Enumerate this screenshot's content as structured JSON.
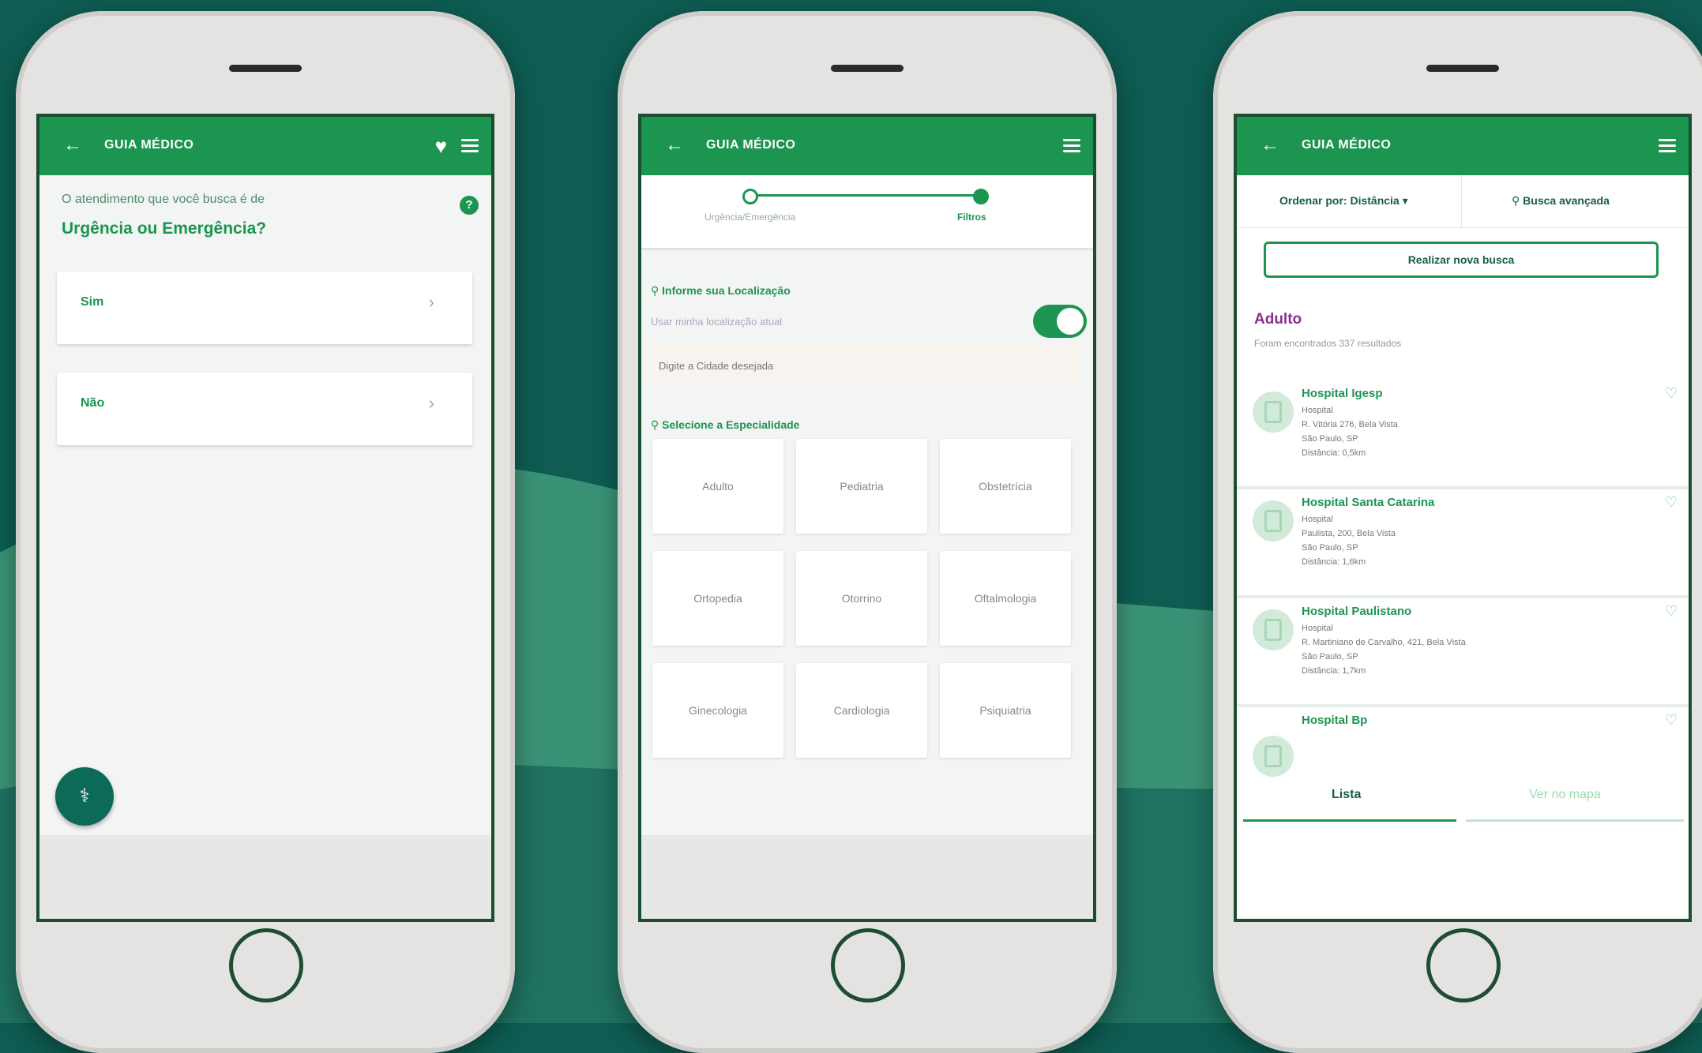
{
  "colors": {
    "brand_green": "#1c9550",
    "dark_green": "#0e5c52",
    "accent_purple": "#8a2d8f"
  },
  "phone1": {
    "title": "GUIA MÉDICO",
    "question": "O atendimento que você busca é de",
    "question_em": "Urgência ou Emergência?",
    "options": [
      {
        "label": "Sim"
      },
      {
        "label": "Não"
      }
    ],
    "icons": [
      "back-icon",
      "heart-icon",
      "menu-icon",
      "help-icon",
      "doctor-icon"
    ]
  },
  "phone2": {
    "title": "GUIA MÉDICO",
    "steps": [
      "Urgência/Emergência",
      "Filtros"
    ],
    "location_label": "Informe sua Localização",
    "use_location": "Usar minha localização atual",
    "toggle_on": true,
    "city_placeholder": "Digite a Cidade desejada",
    "specialty_label": "Selecione a Especialidade",
    "specialties": [
      "Adulto",
      "Pediatria",
      "Obstetrícia",
      "Ortopedia",
      "Otorrino",
      "Oftalmologia",
      "Ginecologia",
      "Cardiologia",
      "Psiquiatria"
    ]
  },
  "phone3": {
    "title": "GUIA MÉDICO",
    "sort": "Ordenar por: Distância",
    "advanced": "Busca avançada",
    "new_search": "Realizar nova busca",
    "result_title": "Adulto",
    "result_count": "Foram encontrados 337 resultados",
    "hospitals": [
      {
        "name": "Hospital Igesp",
        "type": "Hospital",
        "address": "R. Vitória 276, Bela Vista",
        "city": "São Paulo, SP",
        "distance": "Distância: 0,5km"
      },
      {
        "name": "Hospital Santa Catarina",
        "type": "Hospital",
        "address": "Paulista, 200, Bela Vista",
        "city": "São Paulo, SP",
        "distance": "Distância: 1,6km"
      },
      {
        "name": "Hospital Paulistano",
        "type": "Hospital",
        "address": "R. Martiniano de Carvalho, 421, Bela Vista",
        "city": "São Paulo, SP",
        "distance": "Distância: 1,7km"
      },
      {
        "name": "Hospital Bp",
        "type": "",
        "address": "",
        "city": "",
        "distance": ""
      }
    ],
    "tabs": [
      "Lista",
      "Ver no mapa"
    ]
  }
}
